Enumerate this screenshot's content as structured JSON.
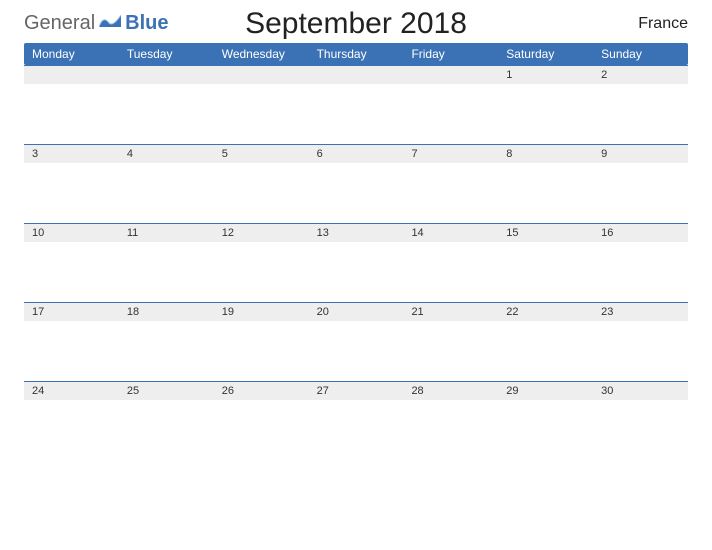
{
  "logo": {
    "word1": "General",
    "word2": "Blue"
  },
  "title": "September 2018",
  "locale": "France",
  "day_names": [
    "Monday",
    "Tuesday",
    "Wednesday",
    "Thursday",
    "Friday",
    "Saturday",
    "Sunday"
  ],
  "weeks": [
    [
      "",
      "",
      "",
      "",
      "",
      "1",
      "2"
    ],
    [
      "3",
      "4",
      "5",
      "6",
      "7",
      "8",
      "9"
    ],
    [
      "10",
      "11",
      "12",
      "13",
      "14",
      "15",
      "16"
    ],
    [
      "17",
      "18",
      "19",
      "20",
      "21",
      "22",
      "23"
    ],
    [
      "24",
      "25",
      "26",
      "27",
      "28",
      "29",
      "30"
    ]
  ]
}
